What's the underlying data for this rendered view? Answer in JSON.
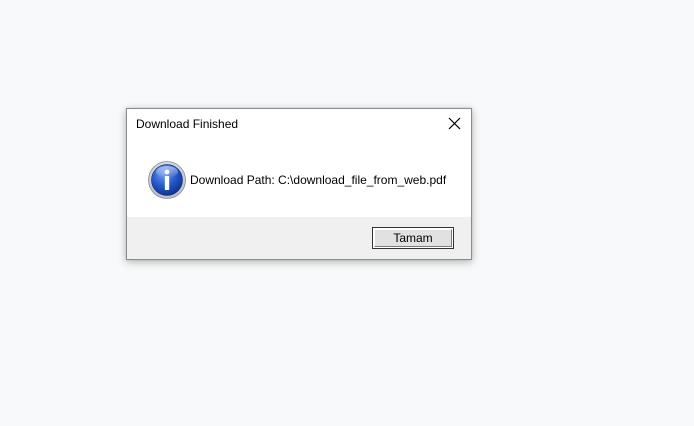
{
  "dialog": {
    "title": "Download Finished",
    "close_icon": "close-icon",
    "icon": "info-icon",
    "message": "Download Path: C:\\download_file_from_web.pdf",
    "ok_label": "Tamam"
  },
  "colors": {
    "desktop_background": "#f8f9fa",
    "dialog_background": "#ffffff",
    "footer_background": "#f0f0f0",
    "info_icon_blue": "#1a4fb5"
  }
}
